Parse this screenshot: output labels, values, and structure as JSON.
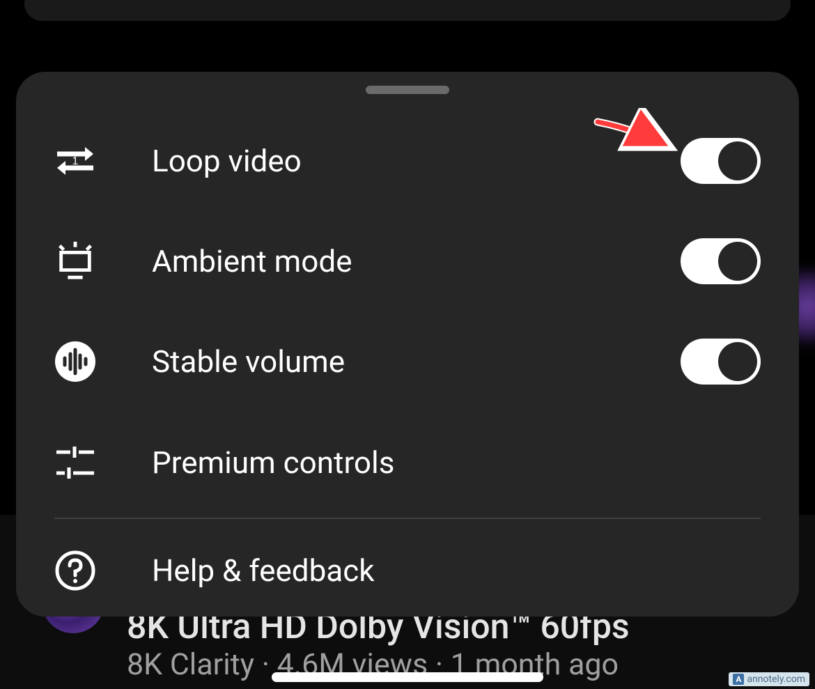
{
  "menu": {
    "loop": {
      "label": "Loop video",
      "enabled": true
    },
    "ambient": {
      "label": "Ambient mode",
      "enabled": true
    },
    "stable_volume": {
      "label": "Stable volume",
      "enabled": true
    },
    "premium_controls": {
      "label": "Premium controls"
    },
    "help": {
      "label": "Help & feedback"
    }
  },
  "background_video": {
    "title": "8K Ultra HD Dolby Vision™ 60fps",
    "channel": "8K Clarity",
    "views": "4.6M views",
    "age": "1 month ago",
    "meta_separator": " · "
  },
  "watermark": {
    "text": "annotely.com",
    "logo_letter": "A"
  }
}
